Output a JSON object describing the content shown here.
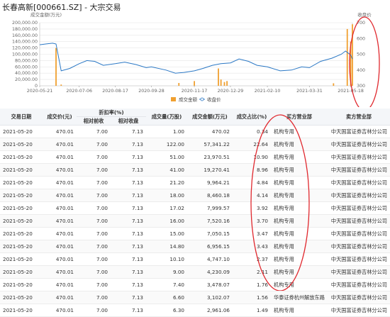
{
  "page_title": "长春高新[000661.SZ] - 大宗交易",
  "colors": {
    "bar": "#f0a030",
    "line": "#2b78c5",
    "annotation": "#e0282e",
    "axis": "#999999"
  },
  "chart_data": {
    "type": "bar+line",
    "ylabel_left": "成交金额(万元)",
    "ylabel_right": "收盘价",
    "ylim_left": [
      0,
      200000
    ],
    "ylim_right": [
      300,
      700
    ],
    "left_ticks": [
      "200,000.00",
      "180,000.00",
      "160,000.00",
      "140,000.00",
      "120,000.00",
      "100,000.00",
      "80,000.00",
      "60,000.00",
      "40,000.00",
      "20,000.00",
      "0"
    ],
    "right_ticks": [
      "700",
      "600",
      "500",
      "400",
      "300"
    ],
    "x_ticks": [
      "2020-05-21",
      "2020-07-06",
      "2020-08-17",
      "2020-09-28",
      "2020-11-17",
      "2020-12-29",
      "2021-02-10",
      "2021-03-31",
      "2021-05-18"
    ],
    "legend": [
      "成交金额",
      "收盘价"
    ],
    "close_series": {
      "name": "收盘价",
      "dates": [
        "2020-05-21",
        "2020-05-28",
        "2020-06-05",
        "2020-06-09",
        "2020-06-15",
        "2020-06-25",
        "2020-07-06",
        "2020-07-15",
        "2020-07-24",
        "2020-08-03",
        "2020-08-17",
        "2020-08-28",
        "2020-09-10",
        "2020-09-22",
        "2020-09-28",
        "2020-10-15",
        "2020-10-26",
        "2020-11-05",
        "2020-11-17",
        "2020-11-27",
        "2020-12-08",
        "2020-12-18",
        "2020-12-29",
        "2021-01-08",
        "2021-01-19",
        "2021-01-29",
        "2021-02-10",
        "2021-02-25",
        "2021-03-10",
        "2021-03-22",
        "2021-03-31",
        "2021-04-13",
        "2021-04-26",
        "2021-05-07",
        "2021-05-12",
        "2021-05-18",
        "2021-05-20"
      ],
      "values": [
        560,
        565,
        570,
        565,
        395,
        410,
        440,
        460,
        455,
        430,
        440,
        450,
        435,
        415,
        420,
        400,
        380,
        385,
        395,
        410,
        430,
        440,
        445,
        470,
        455,
        430,
        420,
        395,
        400,
        420,
        415,
        455,
        475,
        500,
        520,
        495,
        470
      ]
    },
    "amount_series": {
      "name": "成交金额",
      "dates": [
        "2020-06-09",
        "2020-06-15",
        "2020-10-30",
        "2020-11-17",
        "2020-12-15",
        "2020-12-18",
        "2020-12-22",
        "2020-12-25",
        "2021-04-28",
        "2021-05-14",
        "2021-05-18",
        "2021-05-20"
      ],
      "values": [
        120000,
        4000,
        9000,
        15000,
        55000,
        20000,
        12000,
        15000,
        8000,
        180000,
        140000,
        195000
      ]
    }
  },
  "table": {
    "headers": {
      "date": "交易日期",
      "price": "成交价(元)",
      "discount": "折扣率(%)",
      "prev": "相对前收",
      "close": "相对收盘",
      "volume": "成交量(万股)",
      "amount": "成交金额(万元)",
      "ratio": "成交占比(%)",
      "buyer": "买方营业部",
      "seller": "卖方营业部"
    },
    "rows": [
      [
        "2021-05-20",
        "470.01",
        "7.00",
        "7.13",
        "1.00",
        "470.02",
        "0.34",
        "机构专用",
        "中天国富证券吉林分公司"
      ],
      [
        "2021-05-20",
        "470.01",
        "7.00",
        "7.13",
        "122.00",
        "57,341.22",
        "22.64",
        "机构专用",
        "中天国富证券吉林分公司"
      ],
      [
        "2021-05-20",
        "470.01",
        "7.00",
        "7.13",
        "51.00",
        "23,970.51",
        "10.90",
        "机构专用",
        "中天国富证券吉林分公司"
      ],
      [
        "2021-05-20",
        "470.01",
        "7.00",
        "7.13",
        "41.00",
        "19,270.41",
        "8.96",
        "机构专用",
        "中天国富证券吉林分公司"
      ],
      [
        "2021-05-20",
        "470.01",
        "7.00",
        "7.13",
        "21.20",
        "9,964.21",
        "4.84",
        "机构专用",
        "中天国富证券吉林分公司"
      ],
      [
        "2021-05-20",
        "470.01",
        "7.00",
        "7.13",
        "18.00",
        "8,460.18",
        "4.14",
        "机构专用",
        "中天国富证券吉林分公司"
      ],
      [
        "2021-05-20",
        "470.01",
        "7.00",
        "7.13",
        "17.02",
        "7,999.57",
        "3.92",
        "机构专用",
        "中天国富证券吉林分公司"
      ],
      [
        "2021-05-20",
        "470.01",
        "7.00",
        "7.13",
        "16.00",
        "7,520.16",
        "3.70",
        "机构专用",
        "中天国富证券吉林分公司"
      ],
      [
        "2021-05-20",
        "470.01",
        "7.00",
        "7.13",
        "15.00",
        "7,050.15",
        "3.47",
        "机构专用",
        "中天国富证券吉林分公司"
      ],
      [
        "2021-05-20",
        "470.01",
        "7.00",
        "7.13",
        "14.80",
        "6,956.15",
        "3.43",
        "机构专用",
        "中天国富证券吉林分公司"
      ],
      [
        "2021-05-20",
        "470.01",
        "7.00",
        "7.13",
        "10.10",
        "4,747.10",
        "2.37",
        "机构专用",
        "中天国富证券吉林分公司"
      ],
      [
        "2021-05-20",
        "470.01",
        "7.00",
        "7.13",
        "9.00",
        "4,230.09",
        "2.11",
        "机构专用",
        "中天国富证券吉林分公司"
      ],
      [
        "2021-05-20",
        "470.01",
        "7.00",
        "7.13",
        "7.40",
        "3,478.07",
        "1.76",
        "机构专用",
        "中天国富证券吉林分公司"
      ],
      [
        "2021-05-20",
        "470.01",
        "7.00",
        "7.13",
        "6.60",
        "3,102.07",
        "1.56",
        "华泰证券杭州解放东路",
        "中天国富证券吉林分公司"
      ],
      [
        "2021-05-20",
        "470.01",
        "7.00",
        "7.13",
        "6.30",
        "2,961.06",
        "1.49",
        "机构专用",
        "中天国富证券吉林分公司"
      ]
    ]
  }
}
